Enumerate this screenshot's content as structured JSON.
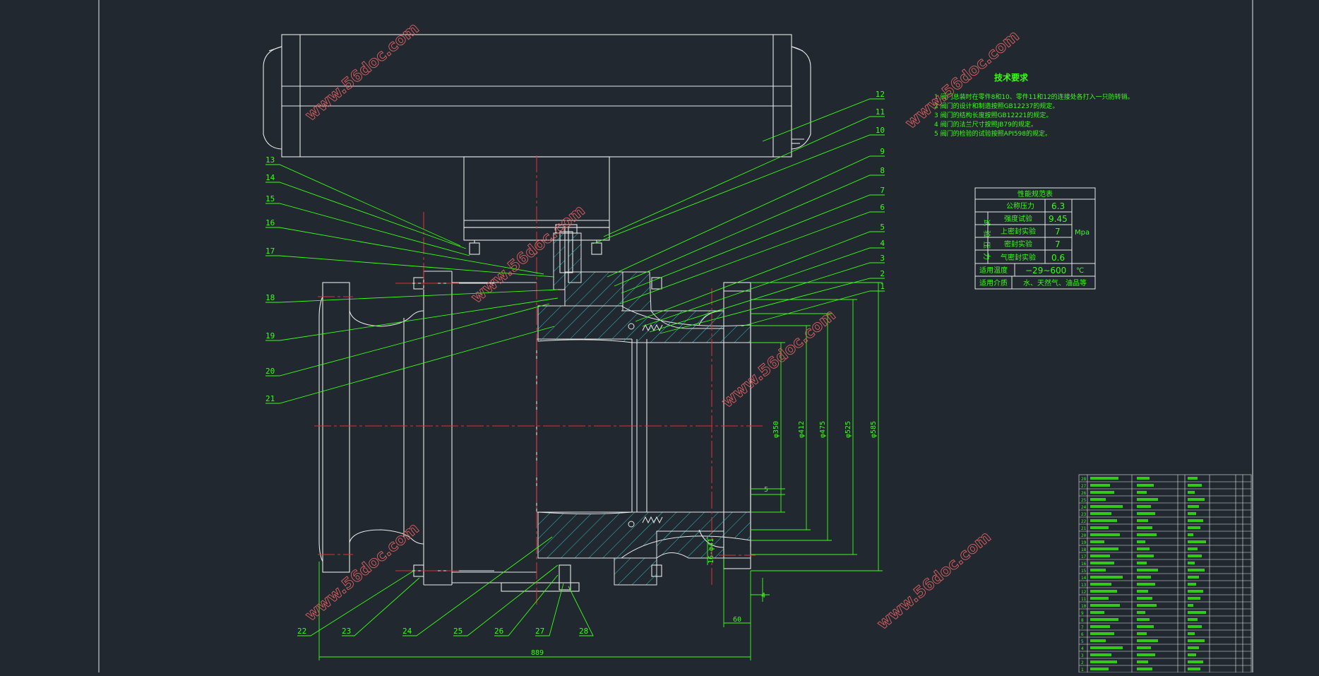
{
  "colors": {
    "background": "#212830",
    "outline": "#e8e8e8",
    "annotation": "#39ff14",
    "centerline": "#e03030",
    "hatch": "#2ec4c4",
    "watermark": "#e06060"
  },
  "balloons_left": [
    "13",
    "14",
    "15",
    "16",
    "17",
    "18",
    "19",
    "20",
    "21"
  ],
  "balloons_right": [
    "12",
    "11",
    "10",
    "9",
    "8",
    "7",
    "6",
    "5",
    "4",
    "3",
    "2",
    "1"
  ],
  "balloons_bottom": [
    "22",
    "23",
    "24",
    "25",
    "26",
    "27",
    "28"
  ],
  "dimensions": {
    "d350": "φ350",
    "d412": "φ412",
    "d475": "φ475",
    "d525": "φ525",
    "d585": "φ585",
    "dim5": "5",
    "dim4": "4",
    "dim60": "60",
    "dim889": "889",
    "bolt": "16-φ41"
  },
  "tech_req": {
    "title": "技术要求",
    "items": [
      "1 阀门总装时在零件8和10、零件11和12的连接处各打入一只防转销。",
      "2 阀门的设计和制造按照GB12237的规定。",
      "3 阀门的结构长度按照GB12221的规定。",
      "4 阀门的法兰尺寸按照JB79的规定。",
      "5 阀门的检验的试验按照API598的规定。"
    ]
  },
  "spec_table": {
    "title": "性能规范表",
    "side_label": "试验压力",
    "rows": [
      {
        "label": "公称压力",
        "value": "6.3"
      },
      {
        "label": "强度试验",
        "value": "9.45"
      },
      {
        "label": "上密封实验",
        "value": "7"
      },
      {
        "label": "密封实验",
        "value": "7"
      },
      {
        "label": "气密封实验",
        "value": "0.6"
      }
    ],
    "unit": "Mpa",
    "temp_label": "适用温度",
    "temp_value": "−29∼600",
    "temp_unit": "℃",
    "medium_label": "适用介质",
    "medium_value": "水、天然气、油品等"
  },
  "bom_numbers": [
    "28",
    "27",
    "26",
    "25",
    "24",
    "23",
    "22",
    "21",
    "20",
    "19",
    "18",
    "17",
    "16",
    "15",
    "14",
    "13",
    "12",
    "11",
    "10",
    "9",
    "8",
    "7",
    "6",
    "5",
    "4",
    "3",
    "2",
    "1"
  ],
  "watermark": "www.56doc.com"
}
